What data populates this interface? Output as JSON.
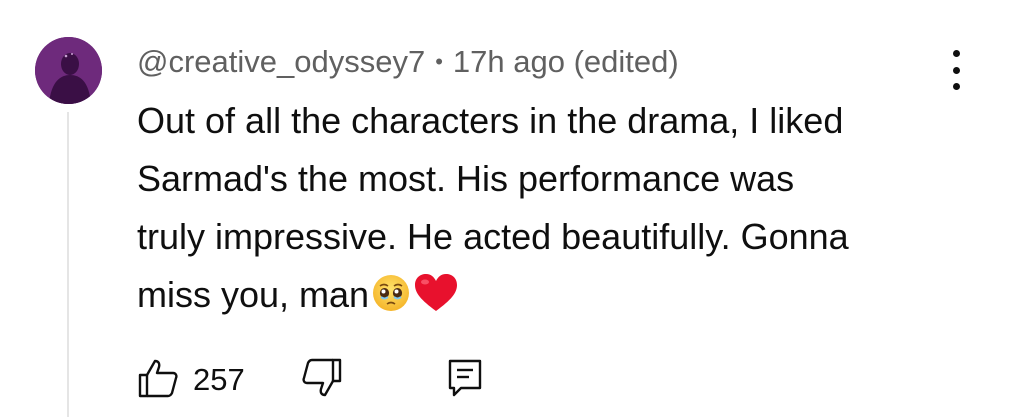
{
  "comment": {
    "author": "@creative_odyssey7",
    "separator": "•",
    "time": "17h ago",
    "edited": "(edited)",
    "lines": [
      "Out of all the characters in the drama, I liked",
      "Sarmad's the most. His performance was",
      "truly impressive. He acted beautifully. Gonna",
      "miss you, man"
    ],
    "emojis": [
      "pleading-face-emoji",
      "red-heart-emoji"
    ],
    "like_count": "257"
  },
  "icons": {
    "more": "more-vert-icon",
    "like": "thumbs-up-icon",
    "dislike": "thumbs-down-icon",
    "reply": "reply-comment-icon"
  },
  "colors": {
    "avatar": "#6e2a7c",
    "text": "#0f0f0f",
    "meta": "#606060",
    "heart": "#e8112d",
    "thread": "#e5e5e5"
  }
}
